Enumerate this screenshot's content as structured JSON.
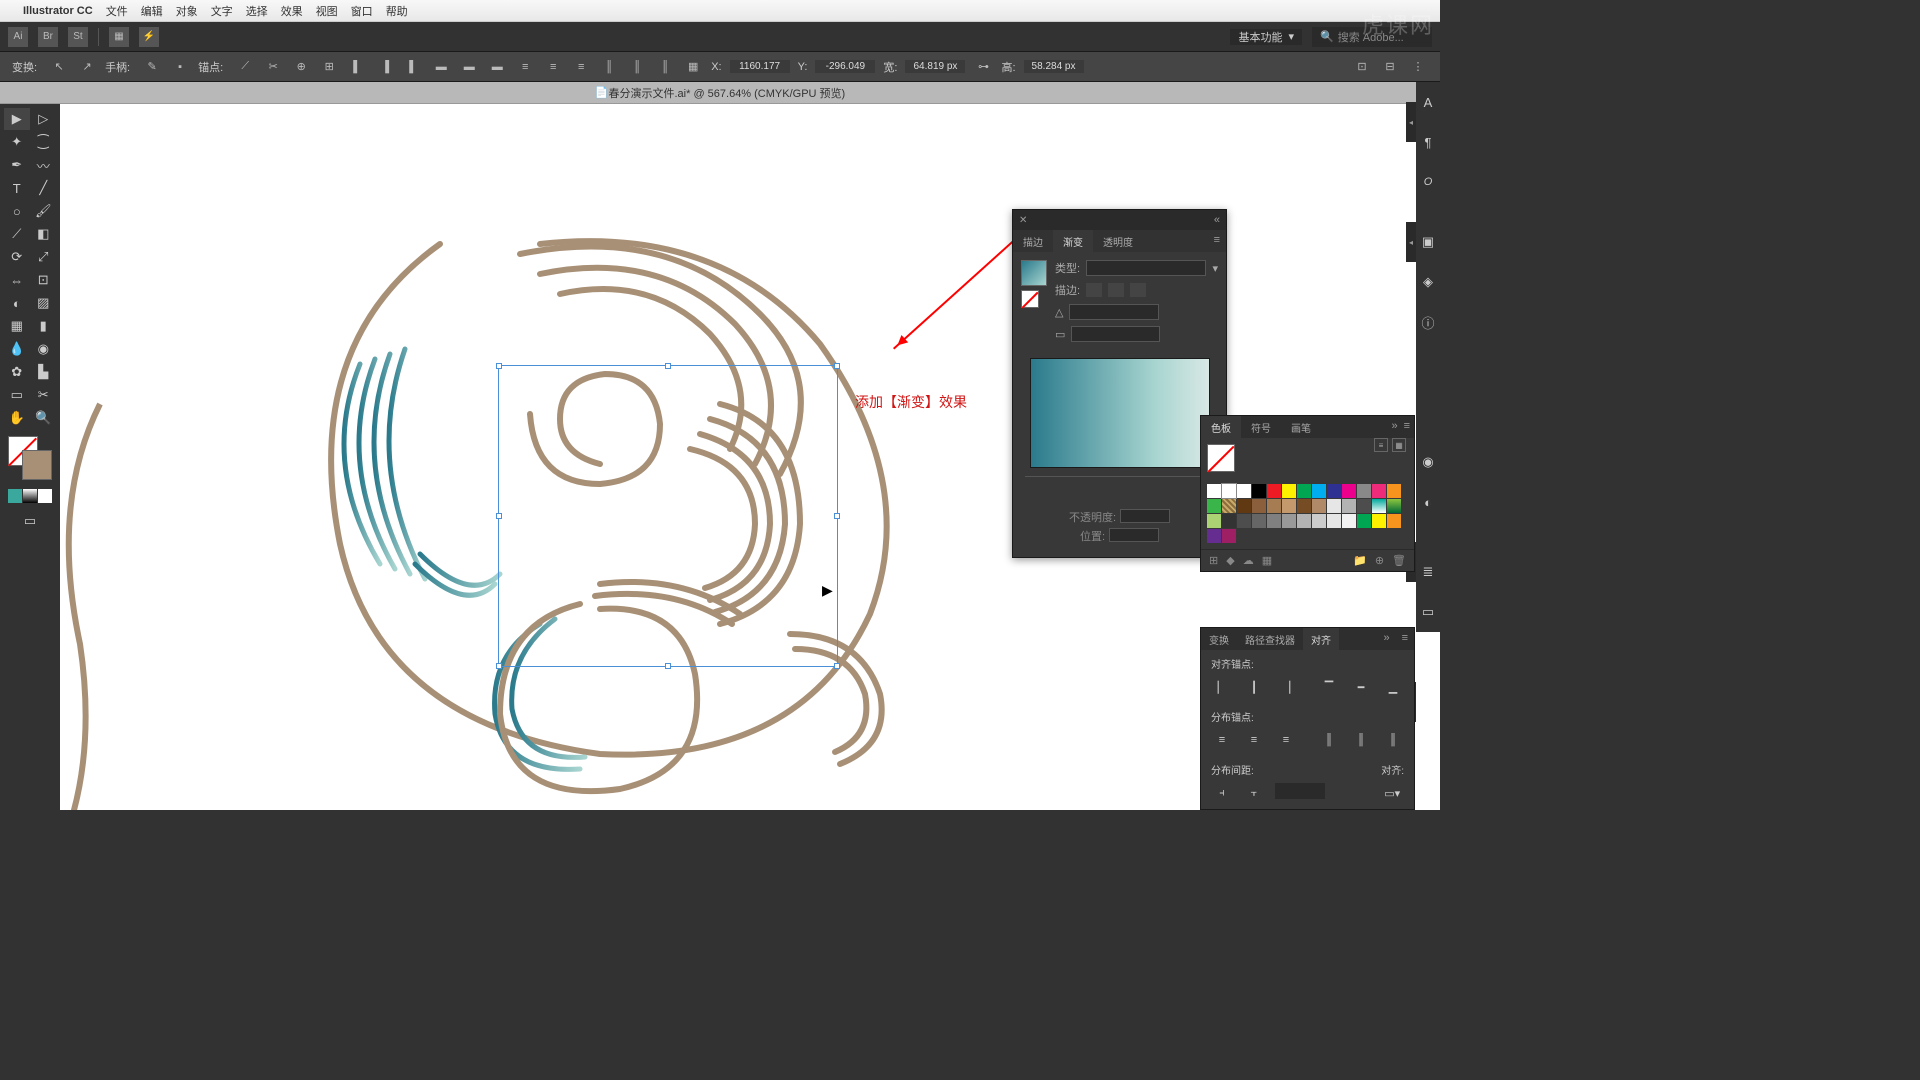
{
  "menubar": {
    "app": "Illustrator CC",
    "items": [
      "文件",
      "编辑",
      "对象",
      "文字",
      "选择",
      "效果",
      "视图",
      "窗口",
      "帮助"
    ]
  },
  "workspace": {
    "label": "基本功能",
    "search": "搜索 Adobe..."
  },
  "control": {
    "transform": "变换:",
    "handle": "手柄:",
    "anchor": "锚点:",
    "x": "X:",
    "xval": "1160.177",
    "y": "Y:",
    "yval": "-296.049",
    "w": "宽:",
    "wval": "64.819 px",
    "h": "高:",
    "hval": "58.284 px"
  },
  "tab": {
    "title": "春分演示文件.ai* @ 567.64% (CMYK/GPU 预览)"
  },
  "annotation": "添加【渐变】效果",
  "gradient": {
    "t1": "描边",
    "t2": "渐变",
    "t3": "透明度",
    "type": "类型:",
    "stroke": "描边:",
    "opacity": "不透明度:",
    "pos": "位置:"
  },
  "swatches": {
    "t1": "色板",
    "t2": "符号",
    "t3": "画笔"
  },
  "align": {
    "t1": "变换",
    "t2": "路径查找器",
    "t3": "对齐",
    "s1": "对齐锚点:",
    "s2": "分布锚点:",
    "s3": "分布间距:",
    "s4": "对齐:"
  },
  "watermark": "虎课网"
}
